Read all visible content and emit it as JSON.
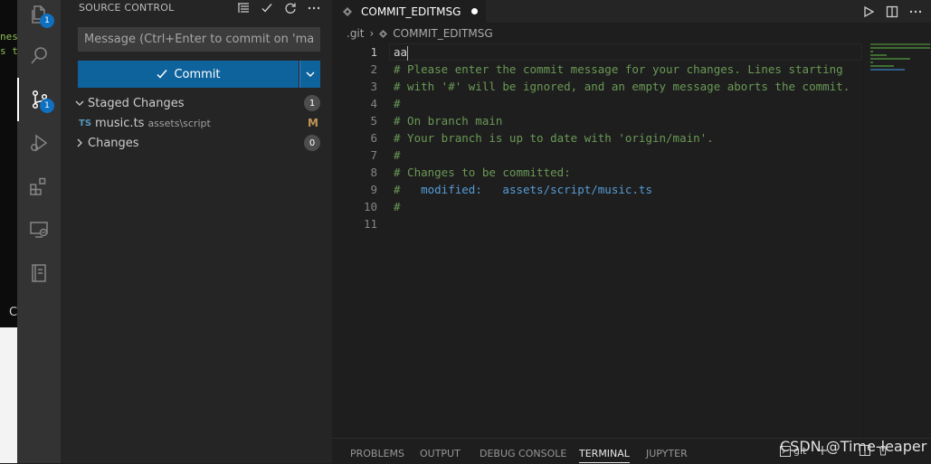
{
  "background_terminal": {
    "lines": [
      "nes",
      "s t"
    ],
    "letter": "C"
  },
  "activity_bar": {
    "explorer_badge": "1",
    "scm_badge": "1"
  },
  "sidebar": {
    "title": "SOURCE CONTROL",
    "message_placeholder": "Message (Ctrl+Enter to commit on 'main')",
    "commit_label": "Commit",
    "staged": {
      "label": "Staged Changes",
      "count": "1"
    },
    "staged_file": {
      "icon": "TS",
      "name": "music.ts",
      "path": "assets\\script",
      "status": "M"
    },
    "changes": {
      "label": "Changes",
      "count": "0"
    }
  },
  "editor": {
    "tab_title": "COMMIT_EDITMSG",
    "breadcrumb": [
      ".git",
      "COMMIT_EDITMSG"
    ],
    "line_numbers": [
      "1",
      "2",
      "3",
      "4",
      "5",
      "6",
      "7",
      "8",
      "9",
      "10",
      "11"
    ],
    "lines": [
      "aa",
      "# Please enter the commit message for your changes. Lines starting",
      "# with '#' will be ignored, and an empty message aborts the commit.",
      "#",
      "# On branch main",
      "# Your branch is up to date with 'origin/main'.",
      "#",
      "# Changes to be committed:",
      "#",
      "#",
      ""
    ],
    "line9_keyword": "   modified:   assets/script/music.ts"
  },
  "panel": {
    "tabs": [
      "PROBLEMS",
      "OUTPUT",
      "DEBUG CONSOLE",
      "TERMINAL",
      "JUPYTER"
    ],
    "active_tab": "TERMINAL",
    "terminal_name": "git"
  },
  "watermark": "CSDN @Time-leaper",
  "colors": {
    "accent": "#0e639c",
    "comment": "#6a9955",
    "keyword": "#569cd6",
    "badge": "#0e70c0",
    "modified": "#c09553"
  }
}
